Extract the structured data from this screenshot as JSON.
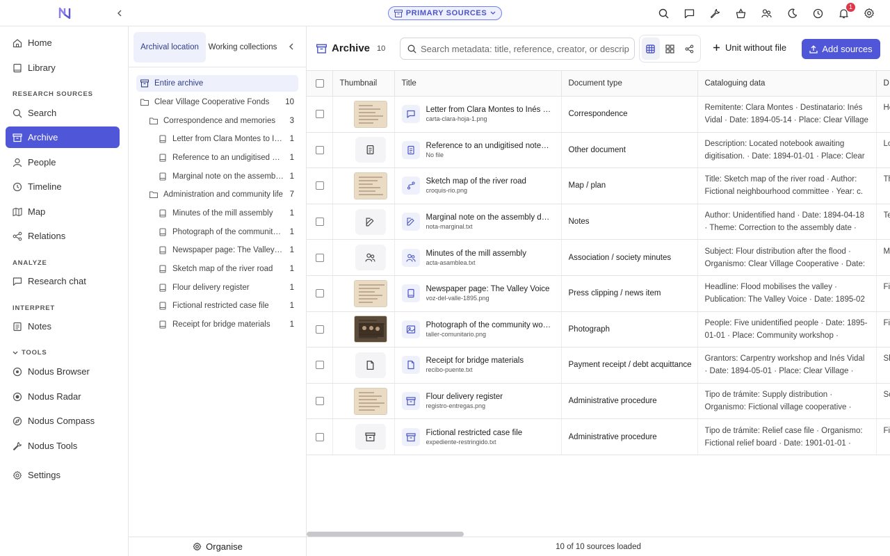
{
  "topbar": {
    "primary_sources_label": "PRIMARY SOURCES",
    "notification_count": "1",
    "icons": [
      "search-icon",
      "chat-icon",
      "wrench-icon",
      "basket-icon",
      "people-icon",
      "moon-icon",
      "clock-icon",
      "bell-icon",
      "gear-icon"
    ]
  },
  "sidebar": {
    "home": "Home",
    "library": "Library",
    "research_heading": "RESEARCH SOURCES",
    "search": "Search",
    "archive": "Archive",
    "people": "People",
    "timeline": "Timeline",
    "map": "Map",
    "relations": "Relations",
    "analyze_heading": "ANALYZE",
    "research_chat": "Research chat",
    "interpret_heading": "INTERPRET",
    "notes": "Notes",
    "tools_heading": "TOOLS",
    "nodus_browser": "Nodus Browser",
    "nodus_radar": "Nodus Radar",
    "nodus_compass": "Nodus Compass",
    "nodus_tools": "Nodus Tools",
    "settings": "Settings"
  },
  "tree": {
    "tab_location": "Archival location",
    "tab_collections": "Working collections",
    "entire_archive": "Entire archive",
    "fonds": {
      "label": "Clear Village Cooperative Fonds",
      "count": "10"
    },
    "group1": {
      "label": "Correspondence and memories",
      "count": "3"
    },
    "group1_items": [
      {
        "label": "Letter from Clara Montes to Inés Vidal",
        "count": "1"
      },
      {
        "label": "Reference to an undigitised notebook",
        "count": "1"
      },
      {
        "label": "Marginal note on the assembly date",
        "count": "1"
      }
    ],
    "group2": {
      "label": "Administration and community life",
      "count": "7"
    },
    "group2_items": [
      {
        "label": "Minutes of the mill assembly",
        "count": "1"
      },
      {
        "label": "Photograph of the community workshop",
        "count": "1"
      },
      {
        "label": "Newspaper page: The Valley Voice",
        "count": "1"
      },
      {
        "label": "Sketch map of the river road",
        "count": "1"
      },
      {
        "label": "Flour delivery register",
        "count": "1"
      },
      {
        "label": "Fictional restricted case file",
        "count": "1"
      },
      {
        "label": "Receipt for bridge materials",
        "count": "1"
      }
    ],
    "organise": "Organise"
  },
  "main": {
    "title": "Archive",
    "count": "10",
    "search_placeholder": "Search metadata: title, reference, creator, or description",
    "unit_without_file": "Unit without file",
    "add_sources": "Add sources",
    "columns": {
      "thumbnail": "Thumbnail",
      "title": "Title",
      "doctype": "Document type",
      "catalog": "Cataloguing data",
      "extra": "D"
    },
    "rows": [
      {
        "title": "Letter from Clara Montes to Inés Vidal",
        "file": "carta-clara-hoja-1.png",
        "doctype": "Correspondence",
        "catalog": "Remitente: Clara Montes · Destinatario: Inés Vidal · Date: 1894-05-14 · Place: Clear Village",
        "extra": "He a",
        "thumb": "image",
        "icon": "chat-icon"
      },
      {
        "title": "Reference to an undigitised notebook",
        "file": "No file",
        "doctype": "Other document",
        "catalog": "Description: Located notebook awaiting digitisation. · Date: 1894-01-01 · Place: Clear Village",
        "extra": "Lo",
        "thumb": "doc-icon",
        "icon": "doc-icon"
      },
      {
        "title": "Sketch map of the river road",
        "file": "croquis-rio.png",
        "doctype": "Map / plan",
        "catalog": "Title: Sketch map of the river road · Author: Fictional neighbourhood committee · Year: c.",
        "extra": "Th ar",
        "thumb": "image",
        "icon": "route-icon"
      },
      {
        "title": "Marginal note on the assembly date",
        "file": "nota-marginal.txt",
        "doctype": "Notes",
        "catalog": "Author: Unidentified hand · Date: 1894-04-18 · Theme: Correction to the assembly date ·",
        "extra": "Te m",
        "thumb": "edit-icon",
        "icon": "edit-icon"
      },
      {
        "title": "Minutes of the mill assembly",
        "file": "acta-asamblea.txt",
        "doctype": "Association / society minutes",
        "catalog": "Subject: Flour distribution after the flood · Organismo: Clear Village Cooperative · Date:",
        "extra": "M da",
        "thumb": "people-icon",
        "icon": "people-icon"
      },
      {
        "title": "Newspaper page: The Valley Voice",
        "file": "voz-del-valle-1895.png",
        "doctype": "Press clipping / news item",
        "catalog": "Headline: Flood mobilises the valley · Publication: The Valley Voice · Date: 1895-02",
        "extra": "Fi re",
        "thumb": "image",
        "icon": "book-icon"
      },
      {
        "title": "Photograph of the community workshop",
        "file": "taller-comunitario.png",
        "doctype": "Photograph",
        "catalog": "People: Five unidentified people · Date: 1895-01-01 · Place: Community workshop ·",
        "extra": "Fi fa",
        "thumb": "image-dark",
        "icon": "photo-icon"
      },
      {
        "title": "Receipt for bridge materials",
        "file": "recibo-puente.txt",
        "doctype": "Payment receipt / debt acquittance",
        "catalog": "Grantors: Carpentry workshop and Inés Vidal · Date: 1894-05-01 · Place: Clear Village ·",
        "extra": "Sh",
        "thumb": "file-icon",
        "icon": "file-icon"
      },
      {
        "title": "Flour delivery register",
        "file": "registro-entregas.png",
        "doctype": "Administrative procedure",
        "catalog": "Tipo de trámite: Supply distribution · Organismo: Fictional village cooperative ·",
        "extra": "Sc",
        "thumb": "image",
        "icon": "archive-box-icon"
      },
      {
        "title": "Fictional restricted case file",
        "file": "expediente-restringido.txt",
        "doctype": "Administrative procedure",
        "catalog": "Tipo de trámite: Relief case file · Organismo: Fictional relief board · Date: 1901-01-01 ·",
        "extra": "Fi co",
        "thumb": "archive-box-icon",
        "icon": "archive-box-icon"
      }
    ],
    "footer": "10 of 10 sources loaded"
  },
  "colors": {
    "accent": "#4f56d8",
    "accent_light": "#eef1fb",
    "border": "#e4e4e7"
  }
}
